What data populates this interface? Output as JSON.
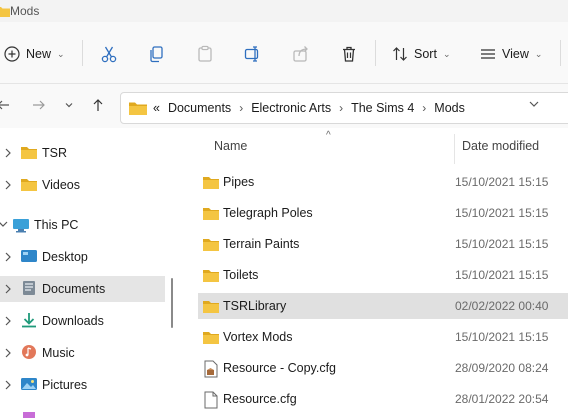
{
  "window": {
    "title": "Mods"
  },
  "toolbar": {
    "new_label": "New",
    "sort_label": "Sort",
    "view_label": "View",
    "icons": [
      "cut-icon",
      "copy-icon",
      "paste-icon",
      "rename-icon",
      "share-icon",
      "delete-icon"
    ]
  },
  "address": {
    "overflow": "«",
    "crumbs": [
      "Documents",
      "Electronic Arts",
      "The Sims 4",
      "Mods"
    ],
    "separator": "›"
  },
  "sidebar": {
    "items": [
      {
        "label": "TSR",
        "icon": "folder-icon"
      },
      {
        "label": "Videos",
        "icon": "folder-icon"
      },
      {
        "label": "This PC",
        "icon": "computer-icon"
      },
      {
        "label": "Desktop",
        "icon": "desktop-icon"
      },
      {
        "label": "Documents",
        "icon": "documents-icon",
        "selected": true
      },
      {
        "label": "Downloads",
        "icon": "downloads-icon"
      },
      {
        "label": "Music",
        "icon": "music-icon"
      },
      {
        "label": "Pictures",
        "icon": "pictures-icon"
      }
    ]
  },
  "columns": {
    "name": "Name",
    "date": "Date modified"
  },
  "files": [
    {
      "name": "Pipes",
      "date": "15/10/2021 15:15",
      "type": "folder"
    },
    {
      "name": "Telegraph Poles",
      "date": "15/10/2021 15:15",
      "type": "folder"
    },
    {
      "name": "Terrain Paints",
      "date": "15/10/2021 15:15",
      "type": "folder"
    },
    {
      "name": "Toilets",
      "date": "15/10/2021 15:15",
      "type": "folder"
    },
    {
      "name": "TSRLibrary",
      "date": "02/02/2022 00:40",
      "type": "folder",
      "selected": true
    },
    {
      "name": "Vortex Mods",
      "date": "15/10/2021 15:15",
      "type": "folder"
    },
    {
      "name": "Resource - Copy.cfg",
      "date": "28/09/2020 08:24",
      "type": "cfg"
    },
    {
      "name": "Resource.cfg",
      "date": "28/01/2022 20:54",
      "type": "file"
    }
  ],
  "colors": {
    "folder": "#f4c542",
    "folder_dark": "#e0a91f",
    "selection": "#e0e0e0",
    "accent": "#2f6fbf"
  }
}
